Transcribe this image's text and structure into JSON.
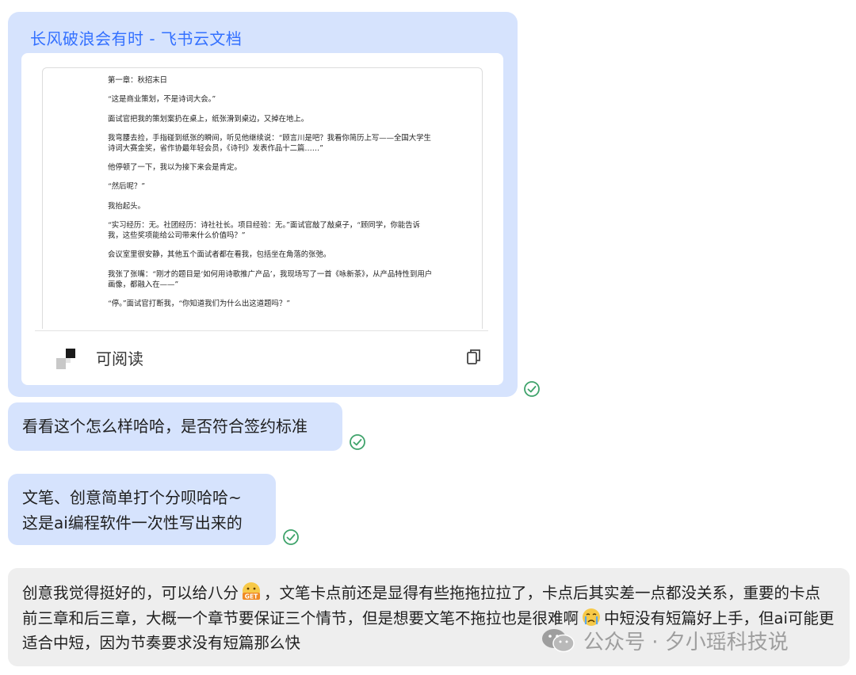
{
  "doc_card": {
    "title": "长风破浪会有时 - 飞书云文档",
    "preview_lines": [
      "第一章：秋招末日",
      "“这是商业策划，不是诗词大会。”",
      "面试官把我的策划案扔在桌上，纸张滑到桌边，又掉在地上。",
      "我弯腰去捡，手指碰到纸张的瞬间，听见他继续说：“顾言川是吧？我看你简历上写——全国大学生诗词大赛金奖，省作协最年轻会员，《诗刊》发表作品十二篇……”",
      "他停顿了一下，我以为接下来会是肯定。",
      "“然后呢？”",
      "我抬起头。",
      "“实习经历：无。社团经历：诗社社长。项目经验：无。”面试官敲了敲桌子，“顾同学，你能告诉我，这些奖项能给公司带来什么价值吗？”",
      "会议室里很安静，其他五个面试者都在看我，包括坐在角落的张弛。",
      "我张了张嘴：“刚才的题目是‘如何用诗歌推广产品’，我现场写了一首《咏新茶》，从产品特性到用户画像，都融入在——”",
      "“停。”面试官打断我，“你知道我们为什么出这道题吗？”"
    ],
    "status_label": "可阅读",
    "icons": [
      "doc-icon",
      "copy-icon"
    ]
  },
  "messages": [
    {
      "text": "看看这个怎么样哈哈，是否符合签约标准",
      "status_icon": "read-check-icon"
    },
    {
      "lines": [
        "文笔、创意简单打个分呗哈哈~",
        "这是ai编程软件一次性写出来的"
      ],
      "status_icon": "read-check-icon"
    }
  ],
  "reply": {
    "part1": "创意我觉得挺好的，可以给八分",
    "emoji1": "get-emoji",
    "part2": "，文笔卡点前还是显得有些拖拖拉拉了，卡点后其实差一点都没关系，重要的卡点前三章和后三章，大概一个章节要保证三个情节，但是想要文笔不拖拉也是很难啊",
    "emoji2": "crying-emoji",
    "part3": "中短没有短篇好上手，但ai可能更适合中短，因为节奏要求没有短篇那么快"
  },
  "watermark": {
    "text": "公众号 · 夕小瑶科技说",
    "icon": "wechat-icon"
  },
  "colors": {
    "sent_bubble": "#d6e3fd",
    "received_bubble": "#eeeeee",
    "link_blue": "#3370ff",
    "check_green": "#3fa36b"
  }
}
